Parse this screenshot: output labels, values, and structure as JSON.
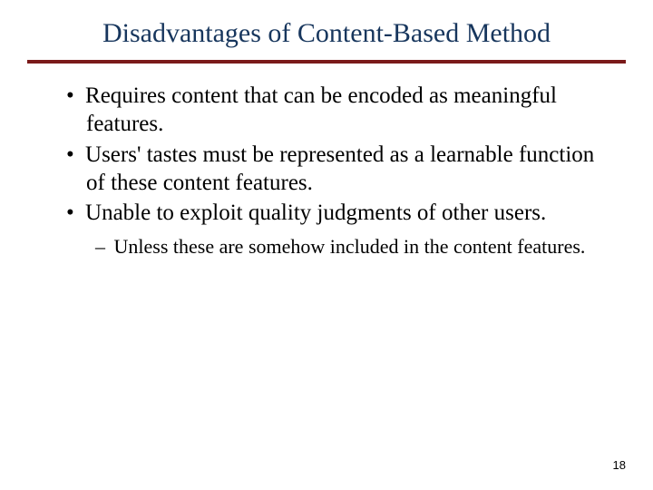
{
  "title": "Disadvantages of Content-Based Method",
  "bullets": [
    "Requires content that can be encoded as meaningful features.",
    "Users' tastes must be represented as a learnable function of these content features.",
    "Unable to exploit quality judgments of other users."
  ],
  "sub_bullet": "Unless these are somehow included in the content features.",
  "page_number": "18"
}
